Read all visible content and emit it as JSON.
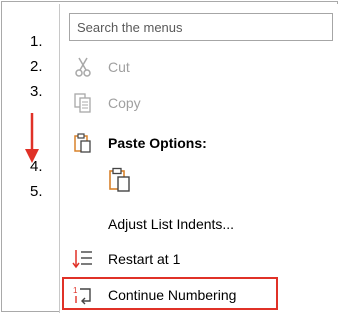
{
  "document": {
    "list_numbers": [
      "1.",
      "2.",
      "3.",
      "4.",
      "5."
    ]
  },
  "menu": {
    "search": {
      "placeholder": "Search the menus",
      "value": ""
    },
    "items": [
      {
        "label": "Cut",
        "icon": "scissors-icon",
        "enabled": false
      },
      {
        "label": "Copy",
        "icon": "copy-icon",
        "enabled": false
      },
      {
        "label": "Paste Options:",
        "icon": "clipboard-icon",
        "heading": true
      },
      {
        "label": "Adjust List Indents...",
        "icon": ""
      },
      {
        "label": "Restart at 1",
        "icon": "restart-numbering-icon"
      },
      {
        "label": "Continue Numbering",
        "icon": "continue-numbering-icon",
        "highlighted": true
      }
    ],
    "paste_option_icon": "keep-text-only-paste-icon"
  },
  "colors": {
    "annotation_red": "#e03127",
    "icon_orange": "#d9822b",
    "disabled_text": "#a0a0a0"
  }
}
